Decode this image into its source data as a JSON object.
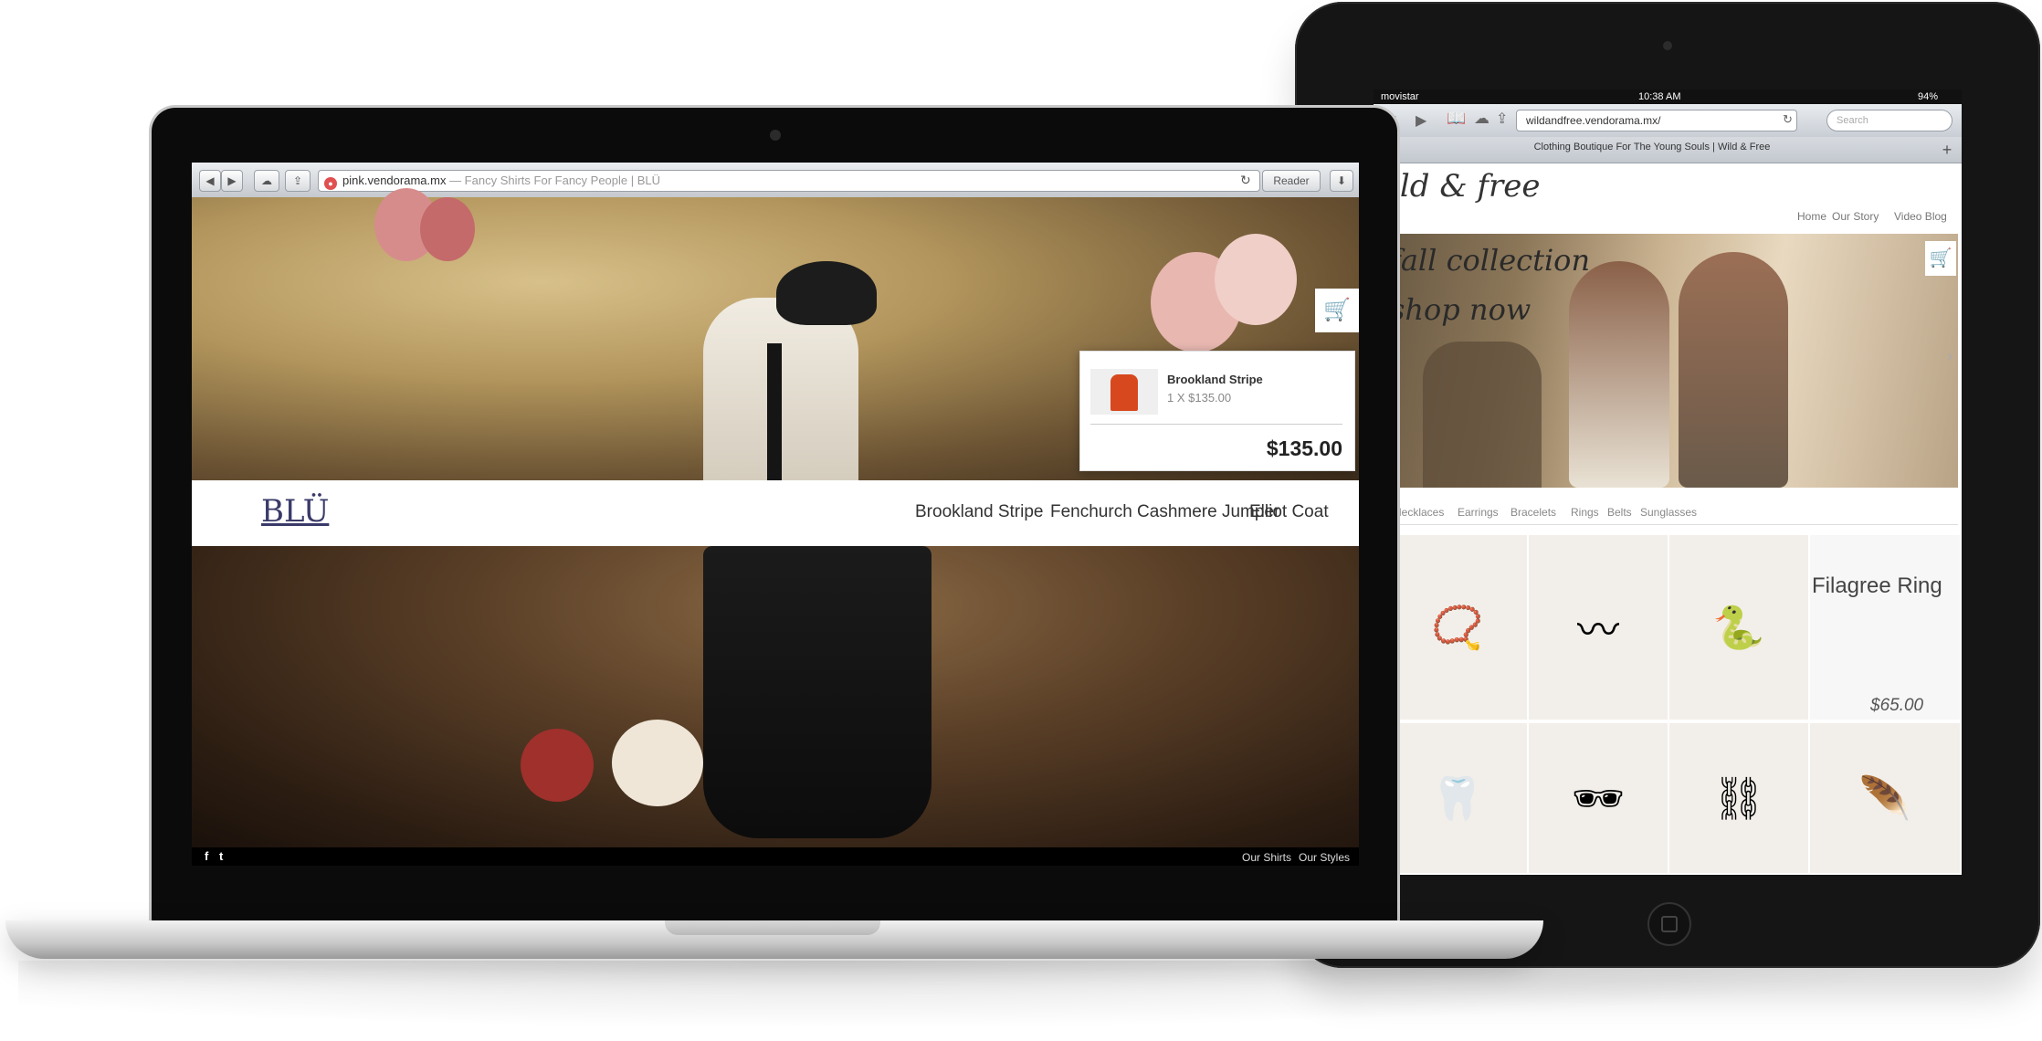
{
  "macbook": {
    "browser": {
      "url_domain": "pink.vendorama.mx",
      "url_title": " — Fancy Shirts For Fancy People | BLÜ",
      "reader_label": "Reader",
      "back_icon": "◀",
      "forward_icon": "▶",
      "cloud_icon": "☁",
      "share_icon": "⇪",
      "reload_icon": "↻",
      "download_icon": "⬇"
    },
    "site": {
      "logo": "BLÜ",
      "nav": [
        "Brookland Stripe",
        "Fenchurch Cashmere Jumper",
        "Elliot Coat"
      ],
      "cart_icon": "🛒",
      "cart_popup": {
        "product": "Brookland Stripe",
        "quantity_price": "1 X $135.00",
        "total": "$135.00"
      },
      "footer": {
        "facebook_icon": "f",
        "twitter_icon": "t",
        "links": [
          "Our Shirts",
          "Our Styles"
        ]
      }
    }
  },
  "ipad": {
    "status": {
      "carrier": "movistar",
      "time": "10:38 AM",
      "battery": "94%"
    },
    "browser": {
      "url": "wildandfree.vendorama.mx/",
      "search_placeholder": "Search",
      "tab_title": "Clothing Boutique For The Young Souls | Wild & Free",
      "plus": "+"
    },
    "site": {
      "logo": "ild & free",
      "nav": [
        "Home",
        "Our Story",
        "Video Blog"
      ],
      "hero_line1": "fall collection",
      "hero_line2": "shop now",
      "categories": [
        "Necklaces",
        "Earrings",
        "Bracelets",
        "Rings",
        "Belts",
        "Sunglasses"
      ],
      "featured_name": "Filagree Ring",
      "featured_price": "$65.00",
      "tile_icons": [
        "bracelet-icon",
        "necklace-icon",
        "belt-icon",
        "ring-icon",
        "earrings-icon",
        "sunglasses-icon",
        "chain-necklace-icon",
        "feather-earring-icon"
      ]
    }
  },
  "colors": {
    "accent_red": "#e05050",
    "logo_blue": "#3a3a6a",
    "device_black": "#151515"
  }
}
